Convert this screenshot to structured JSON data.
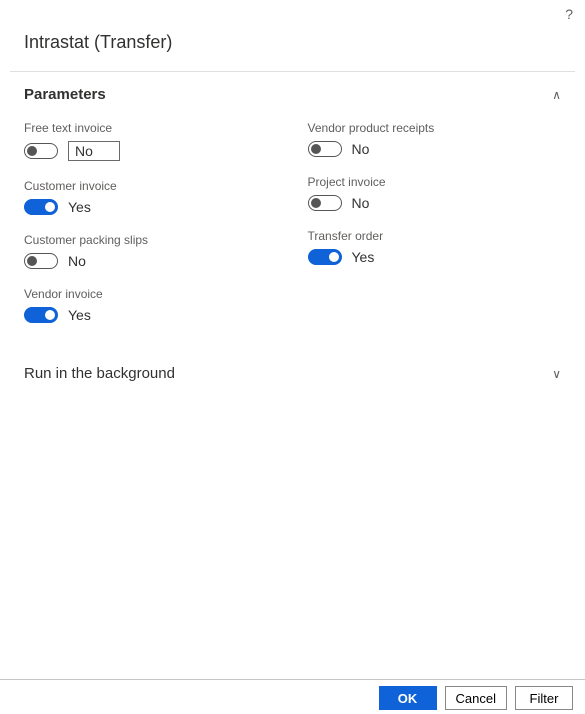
{
  "dialog": {
    "title": "Intrastat (Transfer)"
  },
  "sections": {
    "parameters": {
      "title": "Parameters",
      "expanded": true
    },
    "runBackground": {
      "title": "Run in the background",
      "expanded": false
    }
  },
  "fields": {
    "freeTextInvoice": {
      "label": "Free text invoice",
      "value": "No",
      "on": false
    },
    "customerInvoice": {
      "label": "Customer invoice",
      "value": "Yes",
      "on": true
    },
    "customerPackingSlips": {
      "label": "Customer packing slips",
      "value": "No",
      "on": false
    },
    "vendorInvoice": {
      "label": "Vendor invoice",
      "value": "Yes",
      "on": true
    },
    "vendorProductReceipts": {
      "label": "Vendor product receipts",
      "value": "No",
      "on": false
    },
    "projectInvoice": {
      "label": "Project invoice",
      "value": "No",
      "on": false
    },
    "transferOrder": {
      "label": "Transfer order",
      "value": "Yes",
      "on": true
    }
  },
  "footer": {
    "ok": "OK",
    "cancel": "Cancel",
    "filter": "Filter"
  }
}
